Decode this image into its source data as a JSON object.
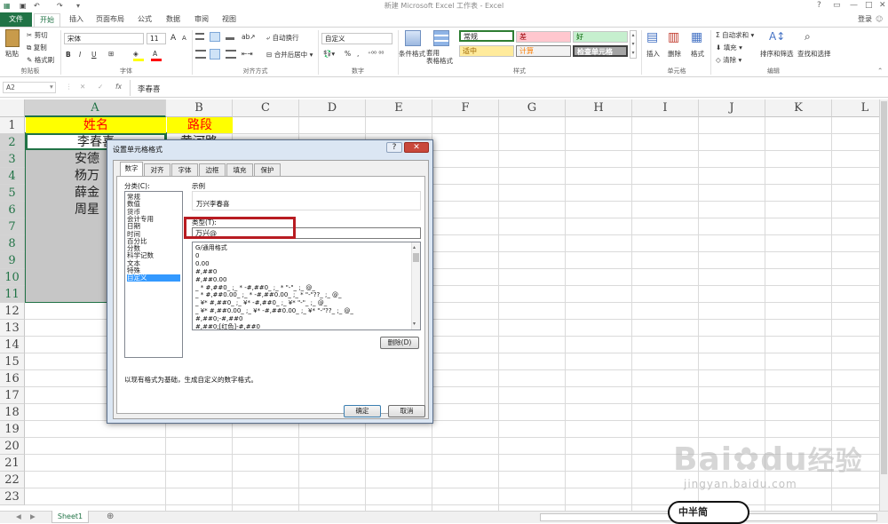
{
  "window": {
    "title": "新建 Microsoft Excel 工作表 - Excel",
    "login": "登录",
    "controls": [
      "?",
      "▭",
      "—",
      "□",
      "✕"
    ]
  },
  "ribbon_tabs": [
    "文件",
    "开始",
    "插入",
    "页面布局",
    "公式",
    "数据",
    "审阅",
    "视图"
  ],
  "clipboard": {
    "paste": "粘贴",
    "cut": "剪切",
    "copy": "复制",
    "format_painter": "格式刷",
    "label": "剪贴板"
  },
  "font": {
    "name": "宋体",
    "size": "11",
    "label": "字体",
    "bold": "B",
    "italic": "I",
    "underline": "U",
    "grow": "A",
    "shrink": "A",
    "color": "A"
  },
  "alignment": {
    "wrap": "自动换行",
    "merge": "合并后居中",
    "label": "对齐方式"
  },
  "number": {
    "format": "自定义",
    "label": "数字",
    "percent": "%",
    "comma": ","
  },
  "styles": {
    "label": "样式",
    "cond_format": "条件格式",
    "table_format": "套用\n表格格式",
    "cells": [
      {
        "text": "常规",
        "bg": "#ffffff",
        "color": "#000000"
      },
      {
        "text": "差",
        "bg": "#ffc7ce",
        "color": "#9c0006"
      },
      {
        "text": "好",
        "bg": "#c6efce",
        "color": "#006100"
      },
      {
        "text": "适中",
        "bg": "#ffeb9c",
        "color": "#9c6500"
      },
      {
        "text": "计算",
        "bg": "#f2f2f2",
        "color": "#fa7d00"
      },
      {
        "text": "检查单元格",
        "bg": "#a5a5a5",
        "color": "#ffffff"
      }
    ]
  },
  "cells_group": {
    "insert": "插入",
    "delete": "删除",
    "format": "格式",
    "label": "单元格"
  },
  "editing": {
    "autosum": "自动求和",
    "fill": "填充",
    "clear": "清除",
    "sort": "排序和筛选",
    "find": "查找和选择",
    "label": "编辑"
  },
  "formula_bar": {
    "name_box": "A2",
    "fx": "fx",
    "value": "李春喜"
  },
  "grid": {
    "columns": [
      "A",
      "B",
      "C",
      "D",
      "E",
      "F",
      "G",
      "H",
      "I",
      "J",
      "K",
      "L"
    ],
    "rows": [
      "1",
      "2",
      "3",
      "4",
      "5",
      "6",
      "7",
      "8",
      "9",
      "10",
      "11",
      "12",
      "13",
      "14",
      "15",
      "16",
      "17",
      "18",
      "19",
      "20",
      "21",
      "22",
      "23"
    ],
    "a_values": [
      "姓名",
      "李春喜",
      "安德",
      "杨万",
      "薛金",
      "周星"
    ],
    "b_values": [
      "路段",
      "黄河路"
    ],
    "header_fill": "#ffff00",
    "header_text_color": "#ff0000"
  },
  "sheet_tabs": {
    "sheet": "Sheet1",
    "add": "⊕"
  },
  "dialog": {
    "title": "设置单元格格式",
    "tabs": [
      "数字",
      "对齐",
      "字体",
      "边框",
      "填充",
      "保护"
    ],
    "category_label": "分类(C):",
    "categories": [
      "常规",
      "数值",
      "货币",
      "会计专用",
      "日期",
      "时间",
      "百分比",
      "分数",
      "科学记数",
      "文本",
      "特殊",
      "自定义"
    ],
    "selected_category": "自定义",
    "sample_label": "示例",
    "sample_value": "万兴李春喜",
    "type_label": "类型(T):",
    "type_value": "万兴@",
    "formats": [
      "G/通用格式",
      "0",
      "0.00",
      "#,##0",
      "#,##0.00",
      "_ * #,##0_ ;_ * -#,##0_ ;_ * \"-\"_ ;_ @_",
      "_ * #,##0.00_ ;_ * -#,##0.00_ ;_ * \"-\"??_ ;_ @_",
      "_ ¥* #,##0_ ;_ ¥* -#,##0_ ;_ ¥* \"-\"_ ;_ @_",
      "_ ¥* #,##0.00_ ;_ ¥* -#,##0.00_ ;_ ¥* \"-\"??_ ;_ @_",
      "#,##0;-#,##0",
      "#,##0;[红色]-#,##0"
    ],
    "delete_button": "删除(D)",
    "description": "以现有格式为基础，生成自定义的数字格式。",
    "ok_button": "确定",
    "cancel_button": "取消",
    "help": "?",
    "close": "✕"
  },
  "watermark": {
    "brand": "Bai",
    "brand2": "du",
    "brand_cn": "经验",
    "url": "jingyan.baidu.com",
    "overlay": "中半简"
  }
}
